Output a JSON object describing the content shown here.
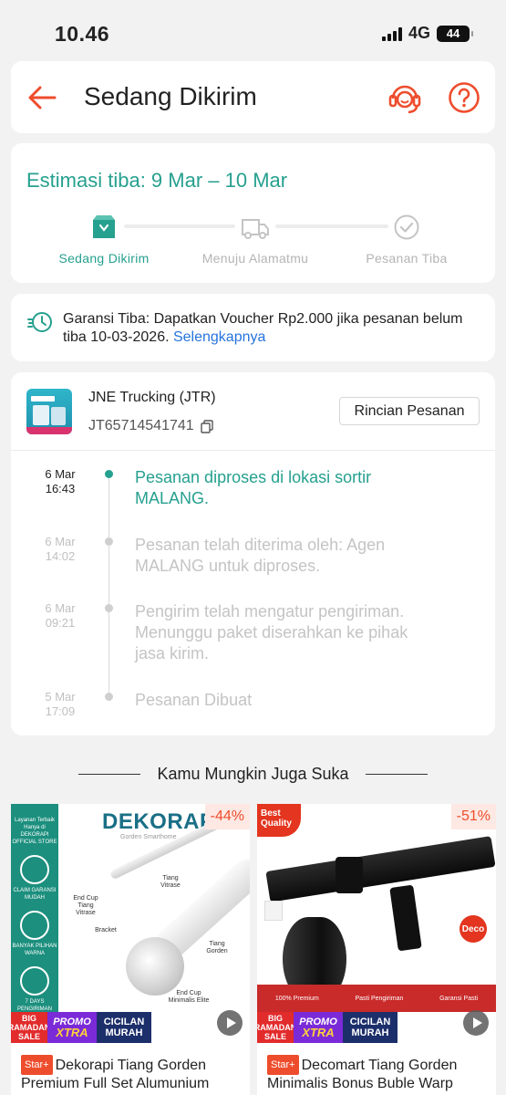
{
  "status_bar": {
    "time": "10.46",
    "network": "4G",
    "battery": "44"
  },
  "header": {
    "title": "Sedang Dikirim"
  },
  "estimate": {
    "title": "Estimasi tiba: 9 Mar – 10 Mar",
    "steps": [
      {
        "label": "Sedang Dikirim",
        "icon": "box-icon",
        "active": true
      },
      {
        "label": "Menuju Alamatmu",
        "icon": "truck-icon",
        "active": false
      },
      {
        "label": "Pesanan Tiba",
        "icon": "check-circle-icon",
        "active": false
      }
    ]
  },
  "guarantee": {
    "text": "Garansi Tiba: Dapatkan Voucher Rp2.000 jika pesanan belum tiba 10-03-2026. ",
    "link": "Selengkapnya"
  },
  "tracking": {
    "courier": "JNE Trucking (JTR)",
    "awb": "JT65714541741",
    "detail_button": "Rincian Pesanan",
    "events": [
      {
        "date": "6 Mar",
        "time": "16:43",
        "text": "Pesanan diproses di lokasi sortir MALANG."
      },
      {
        "date": "6 Mar",
        "time": "14:02",
        "text": "Pesanan telah diterima oleh: Agen MALANG untuk diproses."
      },
      {
        "date": "6 Mar",
        "time": "09:21",
        "text": "Pengirim telah mengatur pengiriman. Menunggu paket diserahkan ke pihak jasa kirim."
      },
      {
        "date": "5 Mar",
        "time": "17:09",
        "text": "Pesanan Dibuat"
      }
    ]
  },
  "recommendations": {
    "title": "Kamu Mungkin Juga Suka",
    "products": [
      {
        "discount": "-44%",
        "badge": "Star+",
        "title": "Dekorapi Tiang Gorden Premium Full Set Alumunium",
        "brand": "DEKORAPI",
        "brand_sub": "Gorden Smarthome",
        "side_store": "Layanan Terbaik Hanya di DEKORAPI OFFICIAL STORE",
        "side_items": [
          "CLAIM GARANSI MUDAH",
          "BANYAK PILIHAN WARNA",
          "7 DAYS PENGIRIMAN"
        ],
        "labels": [
          "Tiang Vitrase",
          "End Cup Tiang Vitrase",
          "Bracket",
          "Tiang Gorden",
          "End Cup Minimalis Elite"
        ]
      },
      {
        "discount": "-51%",
        "badge": "Star+",
        "title": "Decomart Tiang Gorden Minimalis Bonus Buble Warp",
        "corner": "Best Quality",
        "deco": "Deco",
        "strip": [
          "100% Premium",
          "Pasti Pengiriman",
          "Garansi Pasti"
        ]
      }
    ],
    "promo": {
      "big": "BIG RAMADAN SALE",
      "promo_top": "PROMO",
      "promo_bottom": "XTRA",
      "cicilan": "CICILAN MURAH"
    }
  },
  "colors": {
    "accent": "#ee4d2d",
    "teal": "#26a08f",
    "link": "#2673dd"
  }
}
